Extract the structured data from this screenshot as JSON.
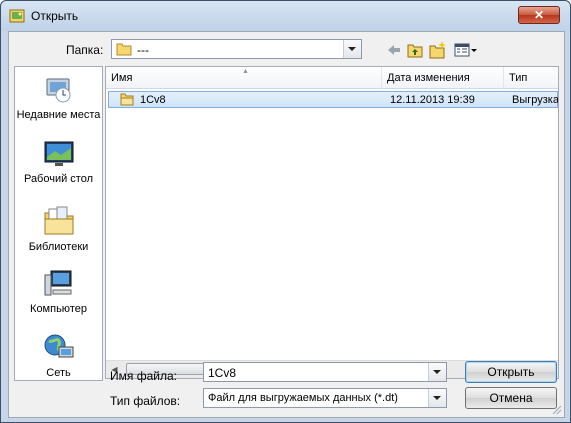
{
  "window": {
    "title": "Открыть",
    "close_glyph": "✕"
  },
  "toolbar": {
    "folder_label": "Папка:",
    "folder_value": "---",
    "icons": [
      "back-icon",
      "up-folder-icon",
      "new-folder-icon",
      "view-menu-icon"
    ]
  },
  "places": [
    {
      "label": "Недавние места",
      "icon": "recent-places-icon"
    },
    {
      "label": "Рабочий стол",
      "icon": "desktop-icon"
    },
    {
      "label": "Библиотеки",
      "icon": "libraries-icon"
    },
    {
      "label": "Компьютер",
      "icon": "computer-icon"
    },
    {
      "label": "Сеть",
      "icon": "network-icon"
    }
  ],
  "filelist": {
    "columns": [
      "Имя",
      "Дата изменения",
      "Тип"
    ],
    "rows": [
      {
        "name": "1Cv8",
        "date": "12.11.2013 19:39",
        "type": "Выгрузка"
      }
    ]
  },
  "form": {
    "filename_label": "Имя файла:",
    "filename_value": "1Cv8",
    "filetype_label": "Тип файлов:",
    "filetype_value": "Файл для выгружаемых данных (*.dt)"
  },
  "buttons": {
    "open": "Открыть",
    "cancel": "Отмена"
  },
  "colors": {
    "selection": "#cfe4f8",
    "title_bar": "#c6d6e8",
    "close_button": "#c75a3e"
  }
}
